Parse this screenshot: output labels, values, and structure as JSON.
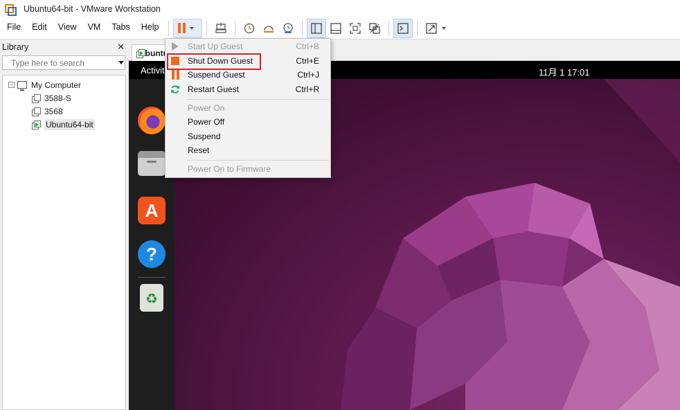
{
  "window": {
    "title": "Ubuntu64-bit - VMware Workstation"
  },
  "menubar": {
    "items": [
      "File",
      "Edit",
      "View",
      "VM",
      "Tabs",
      "Help"
    ]
  },
  "toolbar": {
    "icons": [
      "pause-icon",
      "send-ctrl-alt-del-icon",
      "snapshot-icon",
      "revert-snapshot-icon",
      "snapshot-manager-icon",
      "library-view-icon",
      "thumbnail-bar-icon",
      "full-screen-icon",
      "unity-icon",
      "console-view-icon",
      "stretch-icon"
    ]
  },
  "library": {
    "title": "Library",
    "close": "✕",
    "search_placeholder": "Type here to search",
    "root": "My Computer",
    "vms": [
      {
        "name": "3588-S",
        "running": false
      },
      {
        "name": "3568",
        "running": false
      },
      {
        "name": "Ubuntu64-bit",
        "running": true
      }
    ]
  },
  "tab": {
    "label": "Ubuntu64-bit"
  },
  "guest": {
    "activities": "Activities",
    "clock": "11月 1  17:01",
    "help_glyph": "?",
    "trash_glyph": "♻",
    "appcenter_glyph": "A"
  },
  "power_menu": {
    "items": [
      {
        "label": "Start Up Guest",
        "shortcut": "Ctrl+B",
        "disabled": true,
        "icon": "play-icon"
      },
      {
        "label": "Shut Down Guest",
        "shortcut": "Ctrl+E",
        "disabled": false,
        "icon": "stop-icon",
        "highlighted": true
      },
      {
        "label": "Suspend Guest",
        "shortcut": "Ctrl+J",
        "disabled": false,
        "icon": "pause-icon"
      },
      {
        "label": "Restart Guest",
        "shortcut": "Ctrl+R",
        "disabled": false,
        "icon": "restart-icon"
      },
      {
        "label": "Power On",
        "shortcut": "",
        "disabled": true
      },
      {
        "label": "Power Off",
        "shortcut": "",
        "disabled": false
      },
      {
        "label": "Suspend",
        "shortcut": "",
        "disabled": false
      },
      {
        "label": "Reset",
        "shortcut": "",
        "disabled": false
      },
      {
        "label": "Power On to Firmware",
        "shortcut": "",
        "disabled": true
      }
    ]
  },
  "colors": {
    "accent_orange": "#f06a1a",
    "highlight_red": "#d7202a",
    "ubuntu_purple": "#5e1a4e"
  }
}
